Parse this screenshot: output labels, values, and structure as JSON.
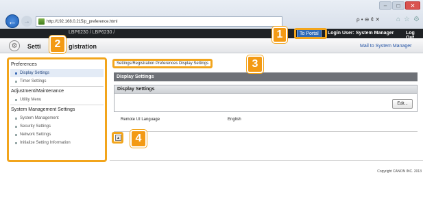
{
  "browser": {
    "url": "http://192.168.0.215/p_preference.html",
    "search_glyphs": "ρ • ⊖ ¢ ✕",
    "icons": [
      "home-icon",
      "star-icon",
      "gear-icon"
    ]
  },
  "header": {
    "device_name": "LBP6230 / LBP6230 /",
    "portal_label": "To Portal",
    "login_label": "Login User: System Manager",
    "logout_label": "Log Out"
  },
  "title_bar": {
    "title_start": "Setti",
    "title_end": "gistration",
    "mail_link": "Mail to System Manager"
  },
  "sidebar": {
    "sections": [
      {
        "heading": "Preferences",
        "items": [
          {
            "label": "Display Settings",
            "active": true
          },
          {
            "label": "Timer Settings",
            "active": false
          }
        ]
      },
      {
        "heading": "Adjustment/Maintenance",
        "items": [
          {
            "label": "Utility Menu",
            "active": false
          }
        ]
      },
      {
        "heading": "System Management Settings",
        "items": [
          {
            "label": "System Management",
            "active": false
          },
          {
            "label": "Security Settings",
            "active": false
          },
          {
            "label": "Network Settings",
            "active": false
          },
          {
            "label": "Initialize Setting Information",
            "active": false
          }
        ]
      }
    ]
  },
  "main": {
    "breadcrumb": "Settings/Registration  Preferences  Display Settings",
    "section_title": "Display Settings",
    "panel_title": "Display Settings",
    "edit_label": "Edit...",
    "setting_label": "Remote UI Language",
    "setting_value": "English",
    "top_glyph": "▲",
    "copyright": "Copyright CANON INC. 2013"
  },
  "callouts": [
    "1",
    "2",
    "3",
    "4"
  ],
  "colors": {
    "callout": "#f39a14",
    "highlight": "#f2a51c",
    "section_bar": "#6e7177",
    "portal": "#2f6ab6"
  }
}
